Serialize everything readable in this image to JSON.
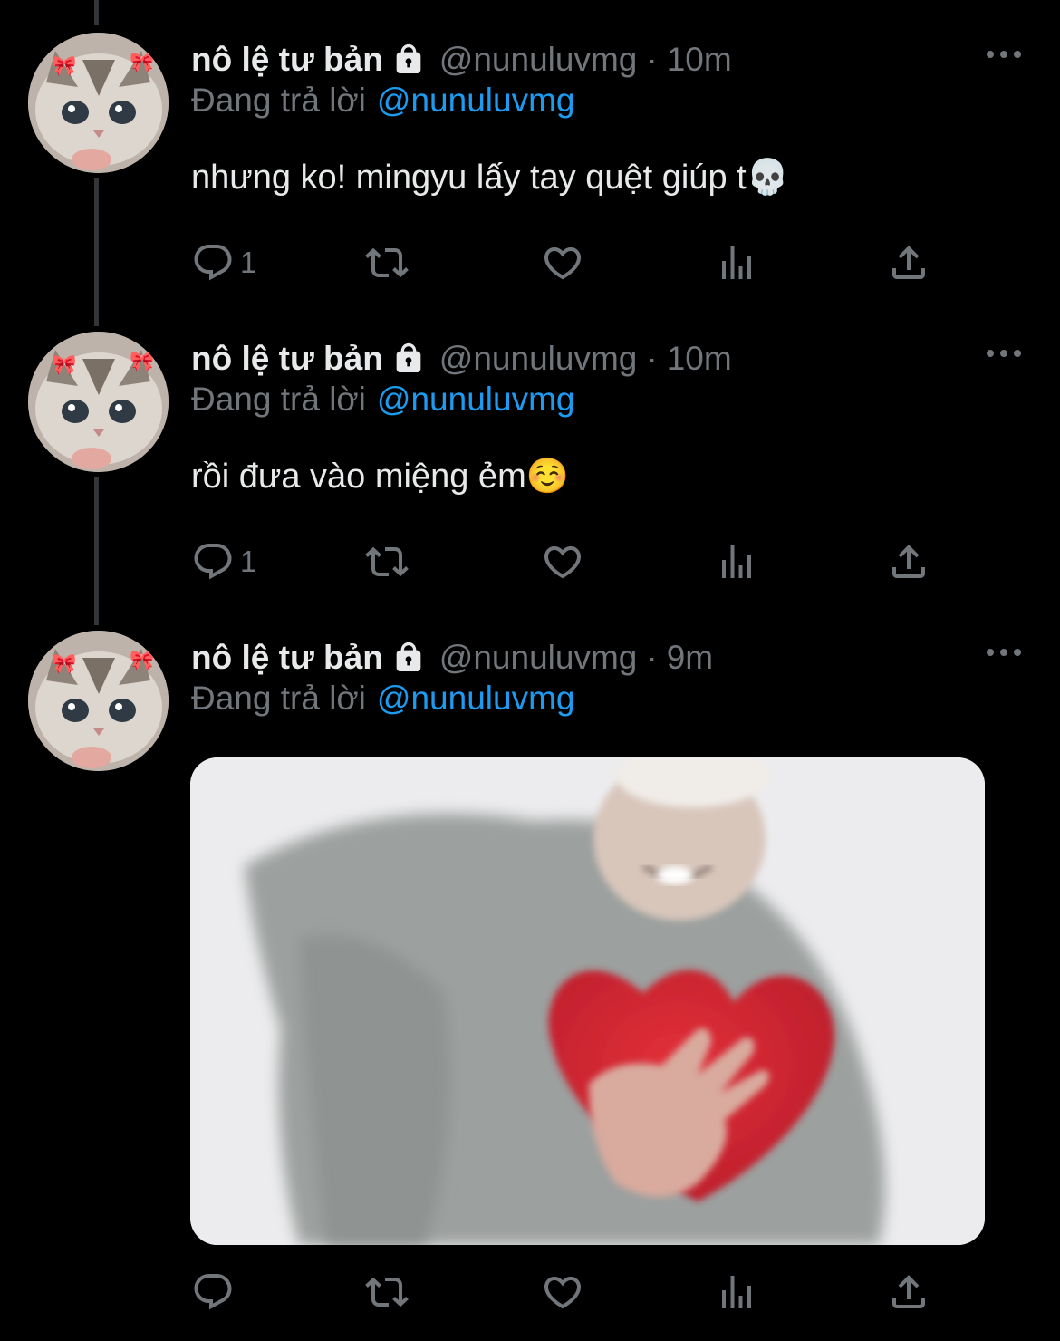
{
  "tweets": [
    {
      "display_name": "nô lệ tư bản",
      "handle": "@nunuluvmg",
      "separator": "·",
      "time": "10m",
      "replying_label": "Đang trả lời",
      "replying_to": "@nunuluvmg",
      "text": "nhưng ko! mingyu lấy tay quệt giúp t💀",
      "reply_count": "1"
    },
    {
      "display_name": "nô lệ tư bản",
      "handle": "@nunuluvmg",
      "separator": "·",
      "time": "10m",
      "replying_label": "Đang trả lời",
      "replying_to": "@nunuluvmg",
      "text": "rồi đưa vào miệng ẻm☺️",
      "reply_count": "1"
    },
    {
      "display_name": "nô lệ tư bản",
      "handle": "@nunuluvmg",
      "separator": "·",
      "time": "9m",
      "replying_label": "Đang trả lời",
      "replying_to": "@nunuluvmg",
      "reply_count": ""
    }
  ],
  "icons": {
    "lock": "lock-icon",
    "more": "more-icon",
    "reply": "reply-icon",
    "retweet": "retweet-icon",
    "like": "heart-icon",
    "views": "analytics-icon",
    "share": "share-icon"
  },
  "colors": {
    "background": "#000000",
    "primary_text": "#e7e9ea",
    "secondary_text": "#71767b",
    "accent": "#1d9bf0",
    "thread_line": "#333639"
  }
}
